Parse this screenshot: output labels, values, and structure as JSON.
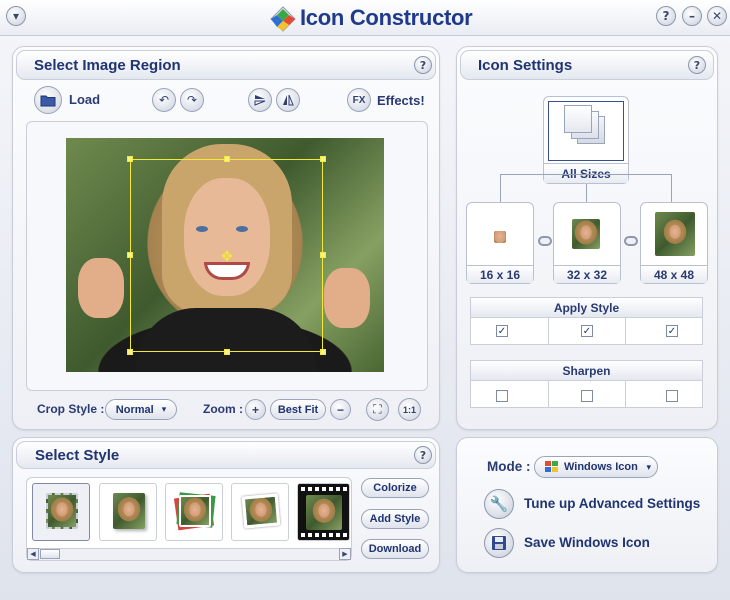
{
  "window": {
    "title": "Icon Constructor",
    "menu_button": "▾",
    "help_button": "?",
    "minimize_button": "–",
    "close_button": "✕"
  },
  "select_region": {
    "title": "Select Image Region",
    "help": "?",
    "load_label": "Load",
    "effects_label": "Effects!",
    "fx_icon_text": "FX",
    "crop_style_label": "Crop Style :",
    "crop_style_value": "Normal",
    "zoom_label": "Zoom :",
    "zoom_in": "+",
    "zoom_best_fit": "Best Fit",
    "zoom_out": "−",
    "one_to_one": "1:1"
  },
  "icon_settings": {
    "title": "Icon Settings",
    "help": "?",
    "all_sizes_label": "All Sizes",
    "sizes": [
      {
        "label": "16 x 16",
        "apply_style": true,
        "sharpen": false
      },
      {
        "label": "32 x 32",
        "apply_style": true,
        "sharpen": false
      },
      {
        "label": "48 x 48",
        "apply_style": true,
        "sharpen": false
      }
    ],
    "apply_style_label": "Apply Style",
    "sharpen_label": "Sharpen",
    "check_mark": "✓"
  },
  "select_style": {
    "title": "Select Style",
    "help": "?",
    "colorize_label": "Colorize",
    "add_style_label": "Add Style",
    "download_label": "Download"
  },
  "mode": {
    "label": "Mode :",
    "value": "Windows Icon",
    "tune_up_label": "Tune up Advanced Settings",
    "save_label": "Save Windows Icon"
  },
  "colors": {
    "accent": "#1f3470",
    "crop_box": "#f2ea3a"
  }
}
